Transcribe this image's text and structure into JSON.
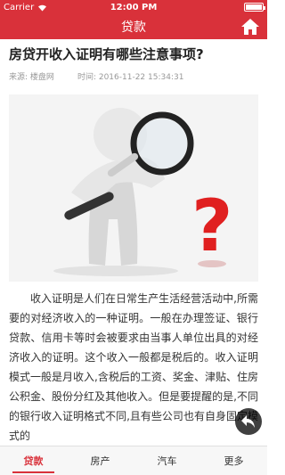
{
  "status_bar": {
    "carrier": "Carrier",
    "time": "12:00 PM"
  },
  "nav": {
    "title": "贷款"
  },
  "article": {
    "title": "房贷开收入证明有哪些注意事项?",
    "source_label": "来源:",
    "source": "楼盘网",
    "time_label": "时间:",
    "time": "2016-11-22 15:34:31",
    "body": "收入证明是人们在日常生产生活经营活动中,所需要的对经济收入的一种证明。一般在办理签证、银行贷款、信用卡等时会被要求由当事人单位出具的对经济收入的证明。这个收入一般都是税后的。收入证明模式一般是月收入,含税后的工资、奖金、津贴、住房公积金、股份分红及其他收入。但是要提醒的是,不同的银行收入证明格式不同,且有些公司也有自身固定模式的"
  },
  "tabs": [
    {
      "label": "贷款",
      "active": true
    },
    {
      "label": "房产",
      "active": false
    },
    {
      "label": "汽车",
      "active": false
    },
    {
      "label": "更多",
      "active": false
    }
  ],
  "colors": {
    "accent": "#d9313a"
  }
}
